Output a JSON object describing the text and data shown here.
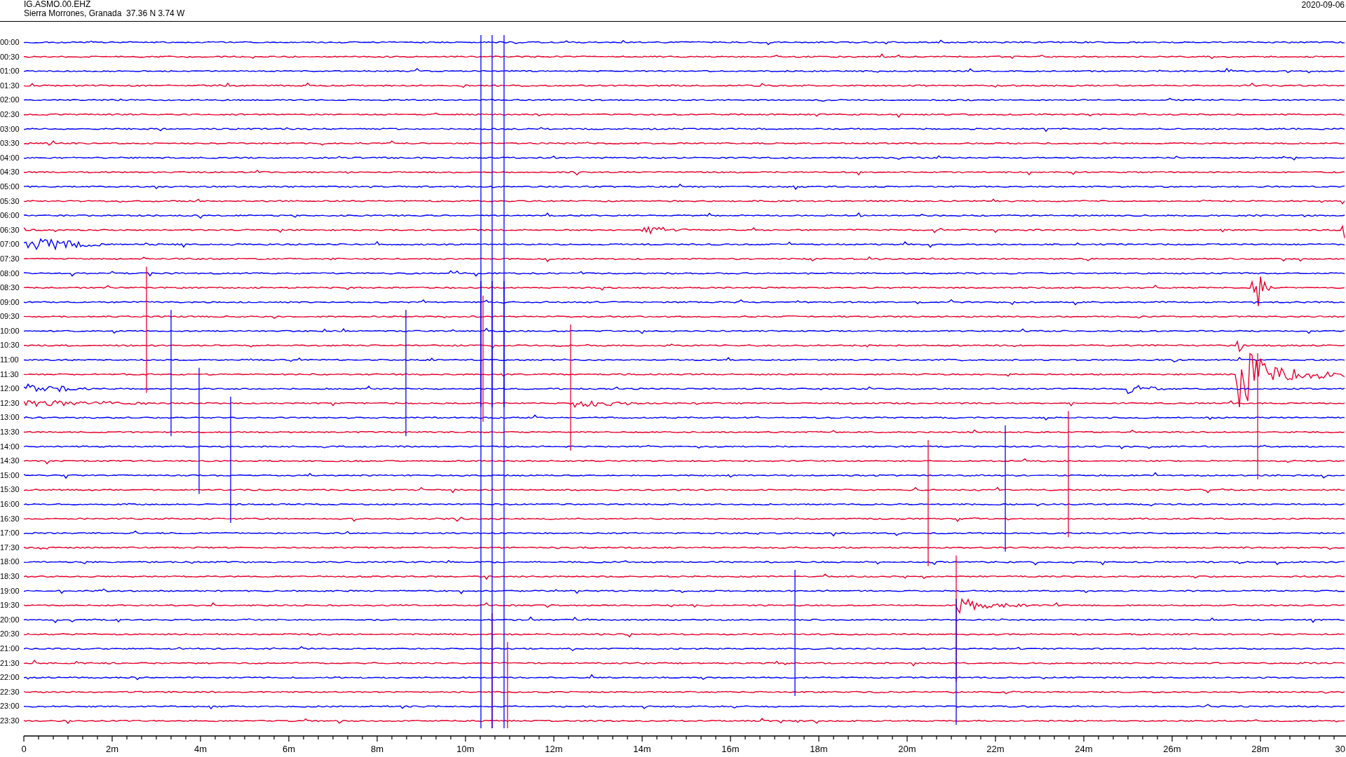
{
  "header": {
    "station": "IG.ASMO.00.EHZ",
    "location": "Sierra Morrones, Granada  37.36 N 3.74 W",
    "date": "2020-09-06"
  },
  "rows": [
    {
      "label": "00:00",
      "color": "#0000ff"
    },
    {
      "label": "00:30",
      "color": "#e8002c"
    },
    {
      "label": "01:00",
      "color": "#0000ff"
    },
    {
      "label": "01:30",
      "color": "#e8002c"
    },
    {
      "label": "02:00",
      "color": "#0000ff"
    },
    {
      "label": "02:30",
      "color": "#e8002c"
    },
    {
      "label": "03:00",
      "color": "#0000ff"
    },
    {
      "label": "03:30",
      "color": "#e8002c"
    },
    {
      "label": "04:00",
      "color": "#0000ff"
    },
    {
      "label": "04:30",
      "color": "#e8002c"
    },
    {
      "label": "05:00",
      "color": "#0000ff"
    },
    {
      "label": "05:30",
      "color": "#e8002c"
    },
    {
      "label": "06:00",
      "color": "#0000ff"
    },
    {
      "label": "06:30",
      "color": "#e8002c"
    },
    {
      "label": "07:00",
      "color": "#0000ff"
    },
    {
      "label": "07:30",
      "color": "#e8002c"
    },
    {
      "label": "08:00",
      "color": "#0000ff"
    },
    {
      "label": "08:30",
      "color": "#e8002c"
    },
    {
      "label": "09:00",
      "color": "#0000ff"
    },
    {
      "label": "09:30",
      "color": "#e8002c"
    },
    {
      "label": "10:00",
      "color": "#0000ff"
    },
    {
      "label": "10:30",
      "color": "#e8002c"
    },
    {
      "label": "11:00",
      "color": "#0000ff"
    },
    {
      "label": "11:30",
      "color": "#e8002c"
    },
    {
      "label": "12:00",
      "color": "#0000ff"
    },
    {
      "label": "12:30",
      "color": "#e8002c"
    },
    {
      "label": "13:00",
      "color": "#0000ff"
    },
    {
      "label": "13:30",
      "color": "#e8002c"
    },
    {
      "label": "14:00",
      "color": "#0000ff"
    },
    {
      "label": "14:30",
      "color": "#e8002c"
    },
    {
      "label": "15:00",
      "color": "#0000ff"
    },
    {
      "label": "15:30",
      "color": "#e8002c"
    },
    {
      "label": "16:00",
      "color": "#0000ff"
    },
    {
      "label": "16:30",
      "color": "#e8002c"
    },
    {
      "label": "17:00",
      "color": "#0000ff"
    },
    {
      "label": "17:30",
      "color": "#e8002c"
    },
    {
      "label": "18:00",
      "color": "#0000ff"
    },
    {
      "label": "18:30",
      "color": "#e8002c"
    },
    {
      "label": "19:00",
      "color": "#0000ff"
    },
    {
      "label": "19:30",
      "color": "#e8002c"
    },
    {
      "label": "20:00",
      "color": "#0000ff"
    },
    {
      "label": "20:30",
      "color": "#e8002c"
    },
    {
      "label": "21:00",
      "color": "#0000ff"
    },
    {
      "label": "21:30",
      "color": "#e8002c"
    },
    {
      "label": "22:00",
      "color": "#0000ff"
    },
    {
      "label": "22:30",
      "color": "#e8002c"
    },
    {
      "label": "23:00",
      "color": "#0000ff"
    },
    {
      "label": "23:30",
      "color": "#e8002c"
    }
  ],
  "x_axis": {
    "labels": [
      "0",
      "2m",
      "4m",
      "6m",
      "8m",
      "10m",
      "12m",
      "14m",
      "16m",
      "18m",
      "20m",
      "22m",
      "24m",
      "26m",
      "28m",
      "30"
    ]
  }
}
